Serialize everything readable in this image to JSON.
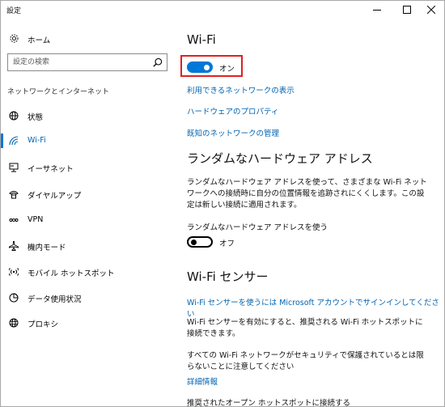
{
  "window": {
    "title": "設定"
  },
  "sidebar": {
    "home_label": "ホーム",
    "search_placeholder": "設定の検索",
    "section_heading": "ネットワークとインターネット",
    "items": [
      {
        "label": "状態",
        "icon": "globe-status-icon"
      },
      {
        "label": "Wi-Fi",
        "icon": "wifi-icon",
        "selected": true
      },
      {
        "label": "イーサネット",
        "icon": "ethernet-icon"
      },
      {
        "label": "ダイヤルアップ",
        "icon": "dialup-icon"
      },
      {
        "label": "VPN",
        "icon": "vpn-icon"
      },
      {
        "label": "機内モード",
        "icon": "airplane-icon"
      },
      {
        "label": "モバイル ホットスポット",
        "icon": "hotspot-icon"
      },
      {
        "label": "データ使用状況",
        "icon": "data-usage-icon"
      },
      {
        "label": "プロキシ",
        "icon": "proxy-globe-icon"
      }
    ]
  },
  "content": {
    "title": "Wi-Fi",
    "wifi_toggle": {
      "state": "on",
      "label": "オン"
    },
    "links": {
      "available_networks": "利用できるネットワークの表示",
      "hardware_properties": "ハードウェアのプロパティ",
      "manage_known": "既知のネットワークの管理"
    },
    "random_hw": {
      "heading": "ランダムなハードウェア アドレス",
      "description": "ランダムなハードウェア アドレスを使って、さまざまな Wi-Fi ネットワークへの接続時に自分の位置情報を追跡されにくくします。この設定は新しい接続に適用されます。",
      "toggle_label": "ランダムなハードウェア アドレスを使う",
      "toggle": {
        "state": "off",
        "label": "オフ"
      }
    },
    "wifi_sense": {
      "heading": "Wi-Fi センサー",
      "signin_link": "Wi-Fi センサーを使うには Microsoft アカウントでサインインしてください",
      "description": "Wi-Fi センサーを有効にすると、推奨される Wi-Fi ホットスポットに接続できます。",
      "warning": "すべての Wi-Fi ネットワークがセキュリティで保護されているとは限らないことに注意してください",
      "more_info": "詳細情報",
      "connect_label": "推奨されたオープン ホットスポットに接続する"
    }
  },
  "colors": {
    "accent": "#0078d7",
    "link": "#0063b1",
    "highlight": "#e02020"
  }
}
